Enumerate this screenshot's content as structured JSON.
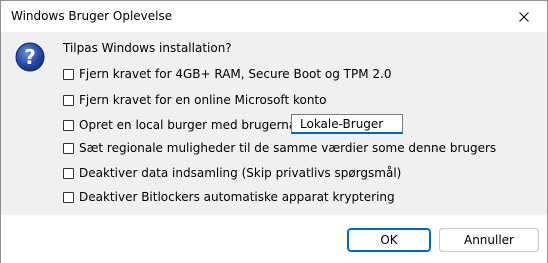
{
  "window": {
    "title": "Windows Bruger Oplevelse"
  },
  "dialog": {
    "icon": "question-icon",
    "prompt": "Tilpas Windows installation?",
    "options": [
      {
        "label": "Fjern kravet for 4GB+ RAM, Secure Boot og TPM 2.0",
        "checked": false
      },
      {
        "label": "Fjern kravet for en online Microsoft konto",
        "checked": false
      },
      {
        "label": "Opret en local burger med brugernavn:",
        "checked": false
      },
      {
        "label": "Sæt regionale muligheder til de samme værdier some denne brugers",
        "checked": false
      },
      {
        "label": "Deaktiver data indsamling (Skip privatlivs spørgsmål)",
        "checked": false
      },
      {
        "label": "Deaktiver Bitlockers automatiske apparat kryptering",
        "checked": false
      }
    ],
    "username_value": "Lokale-Bruger"
  },
  "buttons": {
    "ok": "OK",
    "cancel": "Annuller"
  },
  "colors": {
    "accent": "#0067c0",
    "icon_blue": "#1f4fa8"
  }
}
